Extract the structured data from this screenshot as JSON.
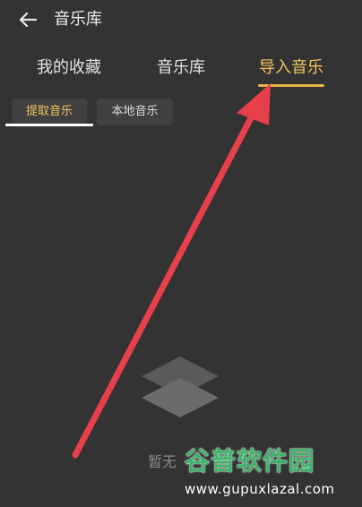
{
  "header": {
    "back_icon": "arrow-left-icon",
    "title": "音乐库"
  },
  "main_tabs": [
    {
      "label": "我的收藏",
      "active": false
    },
    {
      "label": "音乐库",
      "active": false
    },
    {
      "label": "导入音乐",
      "active": true
    }
  ],
  "sub_tabs": [
    {
      "label": "提取音乐",
      "active": true
    },
    {
      "label": "本地音乐",
      "active": false
    }
  ],
  "empty_state": {
    "icon": "layers-icon",
    "text": "暂无"
  },
  "watermark": {
    "brand": "谷普软件园",
    "url": "www.gupuxlazal.com"
  },
  "colors": {
    "background": "#333333",
    "accent": "#f2c35c",
    "annotation_arrow": "#e8404a",
    "watermark_green": "#3db36a"
  }
}
